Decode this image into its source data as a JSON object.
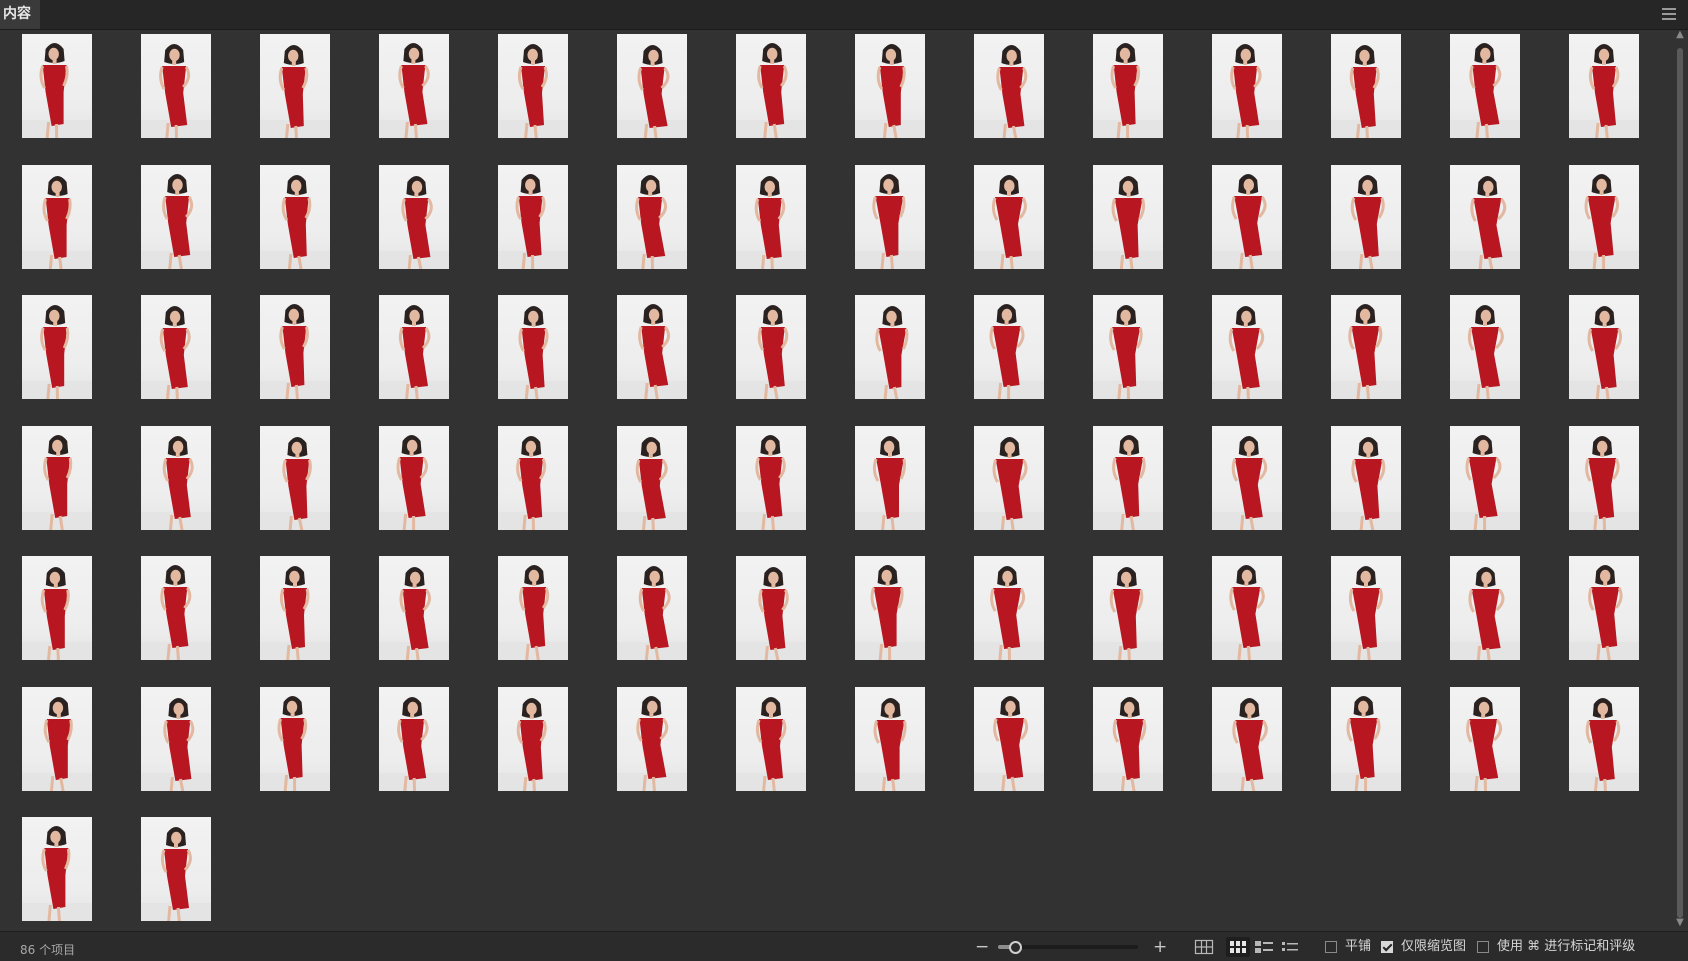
{
  "panel": {
    "tab_title": "内容"
  },
  "grid": {
    "item_count": 86,
    "columns": 14,
    "thumbnail_subject": "studio portrait, red dress, white background",
    "colors": {
      "dress": "#b81620",
      "backdrop": "#eeeeee",
      "skin": "#e3b8a0",
      "hair": "#2a2220"
    }
  },
  "footer": {
    "count_label": "86 个项目",
    "zoom_level": 0.12,
    "options": [
      {
        "label": "平铺",
        "checked": false
      },
      {
        "label": "仅限缩览图",
        "checked": true
      },
      {
        "label": "使用 ⌘ 进行标记和评级",
        "checked": false
      }
    ],
    "view_modes": [
      "grid-view-icon",
      "thumbnail-view-icon",
      "details-view-icon",
      "list-view-icon"
    ],
    "active_view": "thumbnail-view-icon"
  },
  "icons": {
    "panel_menu": "hamburger-menu-icon",
    "zoom_out": "minus-icon",
    "zoom_in": "plus-icon",
    "scroll_up": "chevron-up-icon",
    "scroll_down": "chevron-down-icon"
  }
}
